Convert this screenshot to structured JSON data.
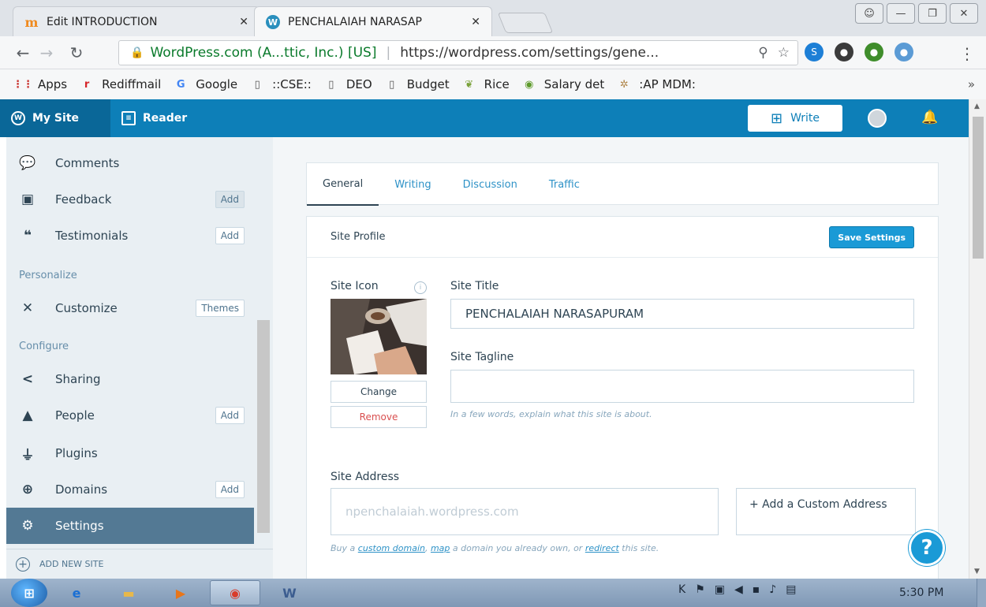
{
  "browser": {
    "tabs": [
      {
        "title": "Edit INTRODUCTION",
        "favicon": "moodle-icon"
      },
      {
        "title": "PENCHALAIAH NARASAP",
        "favicon": "wordpress-icon"
      }
    ],
    "address": {
      "owner": "WordPress.com (A...ttic, Inc.) [US]",
      "url": "https://wordpress.com/settings/gene..."
    },
    "bookmarks": [
      {
        "label": "Apps",
        "icon": "apps-grid-icon",
        "color": "#c9302c"
      },
      {
        "label": "Rediffmail",
        "icon": "rediff-icon",
        "color": "#d6262b"
      },
      {
        "label": "Google",
        "icon": "google-icon",
        "color": "#4285f4"
      },
      {
        "label": "::CSE::",
        "icon": "page-icon",
        "color": "#555555"
      },
      {
        "label": "DEO",
        "icon": "page-icon",
        "color": "#555555"
      },
      {
        "label": "Budget",
        "icon": "page-icon",
        "color": "#555555"
      },
      {
        "label": "Rice",
        "icon": "rice-icon",
        "color": "#7aa23a"
      },
      {
        "label": "Salary det",
        "icon": "salary-icon",
        "color": "#5e9b2c"
      },
      {
        "label": ":AP MDM:",
        "icon": "mdm-icon",
        "color": "#b0864a"
      }
    ],
    "bookmarks_more": "»"
  },
  "masterbar": {
    "my_site": "My Site",
    "reader": "Reader",
    "write": "Write"
  },
  "sidebar": {
    "items_top": [
      {
        "label": "Comments",
        "icon": "comments-icon",
        "button": ""
      },
      {
        "label": "Feedback",
        "icon": "feedback-icon",
        "button": "Add"
      },
      {
        "label": "Testimonials",
        "icon": "quote-icon",
        "button": "Add"
      }
    ],
    "heading_personalize": "Personalize",
    "customize": {
      "label": "Customize",
      "icon": "tools-icon",
      "button": "Themes"
    },
    "heading_configure": "Configure",
    "items_configure": [
      {
        "label": "Sharing",
        "icon": "share-icon",
        "button": ""
      },
      {
        "label": "People",
        "icon": "people-icon",
        "button": "Add"
      },
      {
        "label": "Plugins",
        "icon": "plug-icon",
        "button": ""
      },
      {
        "label": "Domains",
        "icon": "globe-icon",
        "button": "Add"
      },
      {
        "label": "Settings",
        "icon": "cog-icon",
        "button": ""
      }
    ],
    "add_new_site": "ADD NEW SITE"
  },
  "settings": {
    "tabs": [
      "General",
      "Writing",
      "Discussion",
      "Traffic"
    ],
    "section_title": "Site Profile",
    "save_label": "Save Settings",
    "site_icon_label": "Site Icon",
    "change_label": "Change",
    "remove_label": "Remove",
    "site_title_label": "Site Title",
    "site_title_value": "PENCHALAIAH NARASAPURAM",
    "site_tagline_label": "Site Tagline",
    "site_tagline_value": "",
    "tagline_hint": "In a few words, explain what this site is about.",
    "site_address_label": "Site Address",
    "site_address_value": "npenchalaiah.wordpress.com",
    "custom_address_label": "+ Add a Custom Address",
    "address_hint_prefix": "Buy a ",
    "address_hint_link1": "custom domain",
    "address_hint_mid1": ", ",
    "address_hint_link2": "map",
    "address_hint_mid2": " a domain you already own, or ",
    "address_hint_link3": "redirect",
    "address_hint_suffix": " this site."
  },
  "taskbar": {
    "clock": "5:30 PM"
  }
}
